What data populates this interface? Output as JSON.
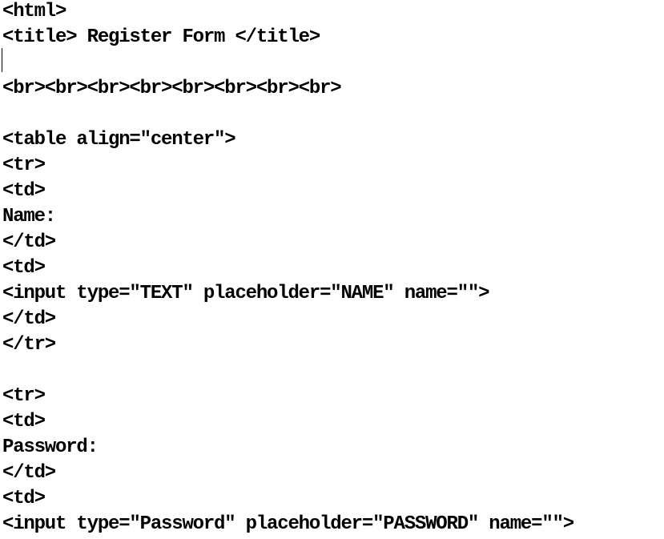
{
  "editor": {
    "lines": [
      "<html>",
      "<title> Register Form </title>",
      "",
      "<br><br><br><br><br><br><br><br>",
      "",
      "<table align=\"center\">",
      "<tr>",
      "<td>",
      "Name:",
      "</td>",
      "<td>",
      "<input type=\"TEXT\" placeholder=\"NAME\" name=\"\">",
      "</td>",
      "</tr>",
      "",
      "<tr>",
      "<td>",
      "Password:",
      "</td>",
      "<td>",
      "<input type=\"Password\" placeholder=\"PASSWORD\" name=\"\">"
    ]
  }
}
